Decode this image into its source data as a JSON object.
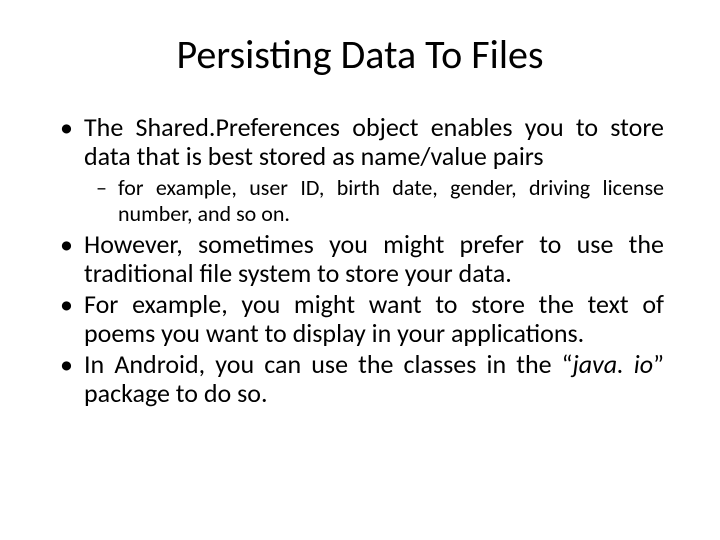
{
  "title": "Persisting Data To Files",
  "bullets": [
    {
      "text": "The Shared.Preferences object enables you to store data that is best stored as name/value pairs",
      "sub": [
        "for example, user ID, birth date, gender, driving license number, and so on."
      ]
    },
    {
      "text": "However, sometimes you might prefer to use the traditional file system to store your data."
    },
    {
      "text": "For example, you might want to store the text of poems you want to display in your applications."
    },
    {
      "text_pre": "In Android, you can use the classes in the “",
      "text_em": "java. io",
      "text_post": "” package to do so."
    }
  ]
}
